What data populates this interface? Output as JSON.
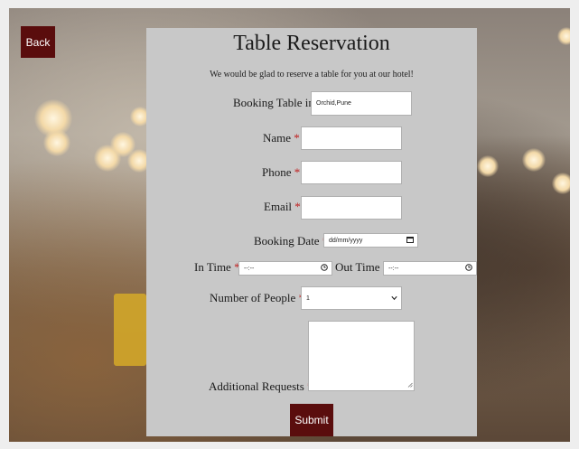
{
  "nav": {
    "back_label": "Back"
  },
  "form": {
    "title": "Table Reservation",
    "subtitle": "We would be glad to reserve a table for you at our hotel!",
    "booking_table": {
      "label": "Booking Table in",
      "value": "Orchid,Pune"
    },
    "name": {
      "label": "Name",
      "value": ""
    },
    "phone": {
      "label": "Phone",
      "value": ""
    },
    "email": {
      "label": "Email",
      "value": ""
    },
    "booking_date": {
      "label": "Booking Date",
      "placeholder": "dd/mm/yyyy"
    },
    "in_time": {
      "label": "In Time",
      "placeholder": "--:--"
    },
    "out_time": {
      "label": "Out Time :",
      "placeholder": "--:--"
    },
    "people": {
      "label": "Number of People",
      "selected": "1"
    },
    "requests": {
      "label": "Additional Requests",
      "value": ""
    },
    "required_mark": "*",
    "submit_label": "Submit"
  },
  "icons": {
    "calendar": "calendar-icon",
    "clock": "clock-icon",
    "chevron": "chevron-down-icon"
  },
  "colors": {
    "button_bg": "#5a0d0d",
    "card_bg": "#c8c8c8",
    "required": "#c02020"
  }
}
